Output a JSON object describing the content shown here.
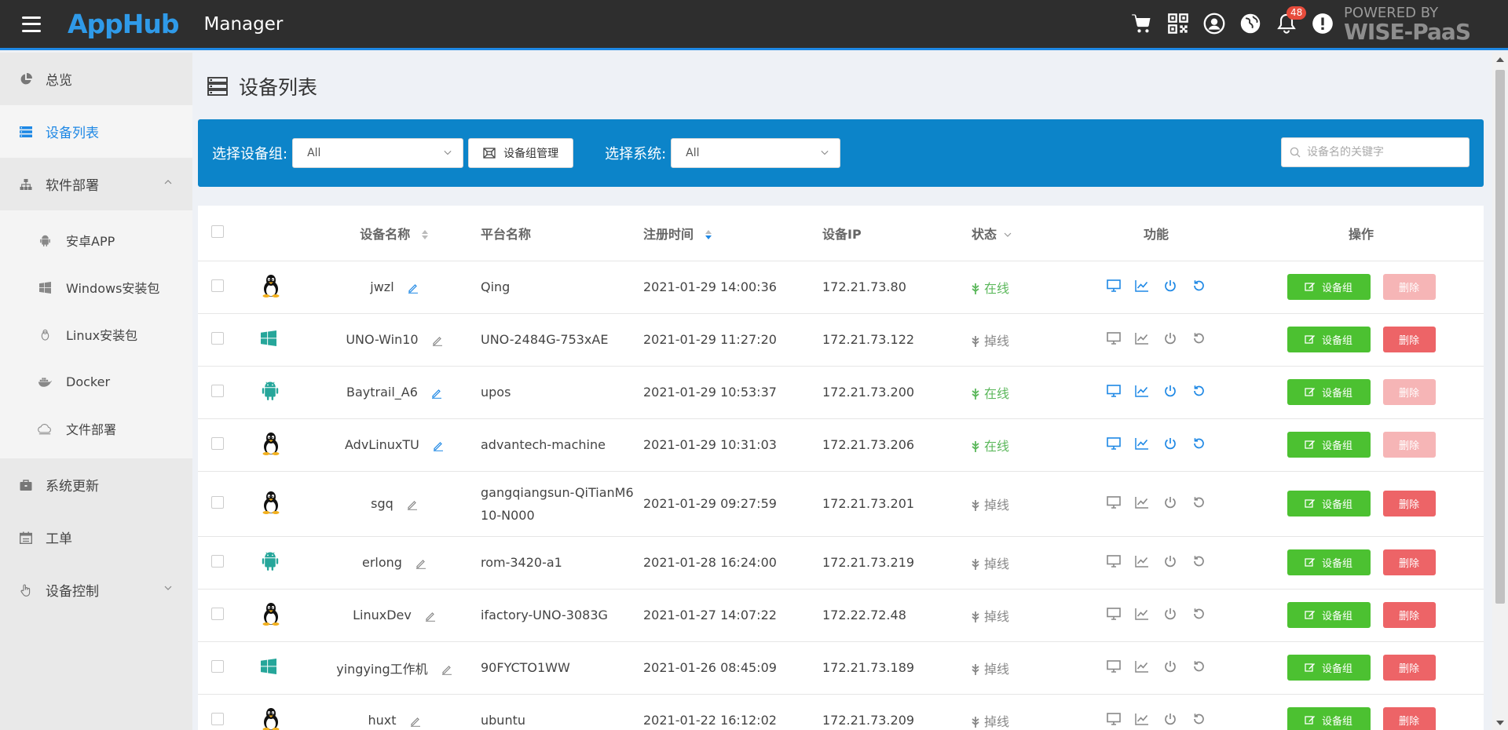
{
  "header": {
    "logo": "AppHub",
    "title": "Manager",
    "notification_count": "48",
    "powered_line1": "POWERED BY",
    "powered_line2": "WISE-PaaS",
    "icons": [
      "cart-icon",
      "qrcode-icon",
      "user-icon",
      "globe-icon",
      "bell-icon",
      "alert-icon"
    ]
  },
  "sidebar": {
    "items": [
      {
        "label": "总览",
        "icon": "pie-chart-icon"
      },
      {
        "label": "设备列表",
        "icon": "list-icon",
        "active": true
      },
      {
        "label": "软件部署",
        "icon": "sitemap-icon",
        "expanded": true
      },
      {
        "label": "系统更新",
        "icon": "briefcase-icon"
      },
      {
        "label": "工单",
        "icon": "calendar-icon"
      },
      {
        "label": "设备控制",
        "icon": "hand-icon"
      }
    ],
    "sub_items": [
      {
        "label": "安卓APP",
        "icon": "android-icon"
      },
      {
        "label": "Windows安装包",
        "icon": "windows-icon"
      },
      {
        "label": "Linux安装包",
        "icon": "linux-icon"
      },
      {
        "label": "Docker",
        "icon": "docker-icon"
      },
      {
        "label": "文件部署",
        "icon": "cloud-icon"
      }
    ]
  },
  "page": {
    "title": "设备列表"
  },
  "filters": {
    "group_label": "选择设备组:",
    "group_value": "All",
    "group_manage_label": "设备组管理",
    "system_label": "选择系统:",
    "system_value": "All",
    "search_placeholder": "设备名的关键字"
  },
  "table": {
    "headers": {
      "name": "设备名称",
      "platform": "平台名称",
      "time": "注册时间",
      "ip": "设备IP",
      "status": "状态",
      "func": "功能",
      "op": "操作"
    },
    "group_button": "设备组",
    "delete_button": "删除",
    "rows": [
      {
        "os": "linux",
        "name": "jwzl",
        "platform": "Qing",
        "time": "2021-01-29 14:00:36",
        "ip": "172.21.73.80",
        "status": "在线",
        "online": true
      },
      {
        "os": "windows",
        "name": "UNO-Win10",
        "platform": "UNO-2484G-753xAE",
        "time": "2021-01-29 11:27:20",
        "ip": "172.21.73.122",
        "status": "掉线",
        "online": false
      },
      {
        "os": "android",
        "name": "Baytrail_A6",
        "platform": "upos",
        "time": "2021-01-29 10:53:37",
        "ip": "172.21.73.200",
        "status": "在线",
        "online": true
      },
      {
        "os": "linux",
        "name": "AdvLinuxTU",
        "platform": "advantech-machine",
        "time": "2021-01-29 10:31:03",
        "ip": "172.21.73.206",
        "status": "在线",
        "online": true
      },
      {
        "os": "linux",
        "name": "sgq",
        "platform": "gangqiangsun-QiTianM610-N000",
        "platform_l1": "gangqiangsun-QiTianM6",
        "platform_l2": "10-N000",
        "time": "2021-01-29 09:27:59",
        "ip": "172.21.73.201",
        "status": "掉线",
        "online": false
      },
      {
        "os": "android",
        "name": "erlong",
        "platform": "rom-3420-a1",
        "time": "2021-01-28 16:24:00",
        "ip": "172.21.73.219",
        "status": "掉线",
        "online": false
      },
      {
        "os": "linux",
        "name": "LinuxDev",
        "platform": "ifactory-UNO-3083G",
        "time": "2021-01-27 14:07:22",
        "ip": "172.22.72.48",
        "status": "掉线",
        "online": false
      },
      {
        "os": "windows",
        "name": "yingying工作机",
        "platform": "90FYCTO1WW",
        "time": "2021-01-26 08:45:09",
        "ip": "172.21.73.189",
        "status": "掉线",
        "online": false
      },
      {
        "os": "linux",
        "name": "huxt",
        "platform": "ubuntu",
        "time": "2021-01-22 16:12:02",
        "ip": "172.21.73.209",
        "status": "掉线",
        "online": false
      }
    ]
  },
  "colors": {
    "accent": "#1e88e5",
    "filter_bar": "#0c84c9",
    "online": "#5cb85c",
    "group_button": "#4cc131",
    "delete_button": "#ed6467"
  }
}
